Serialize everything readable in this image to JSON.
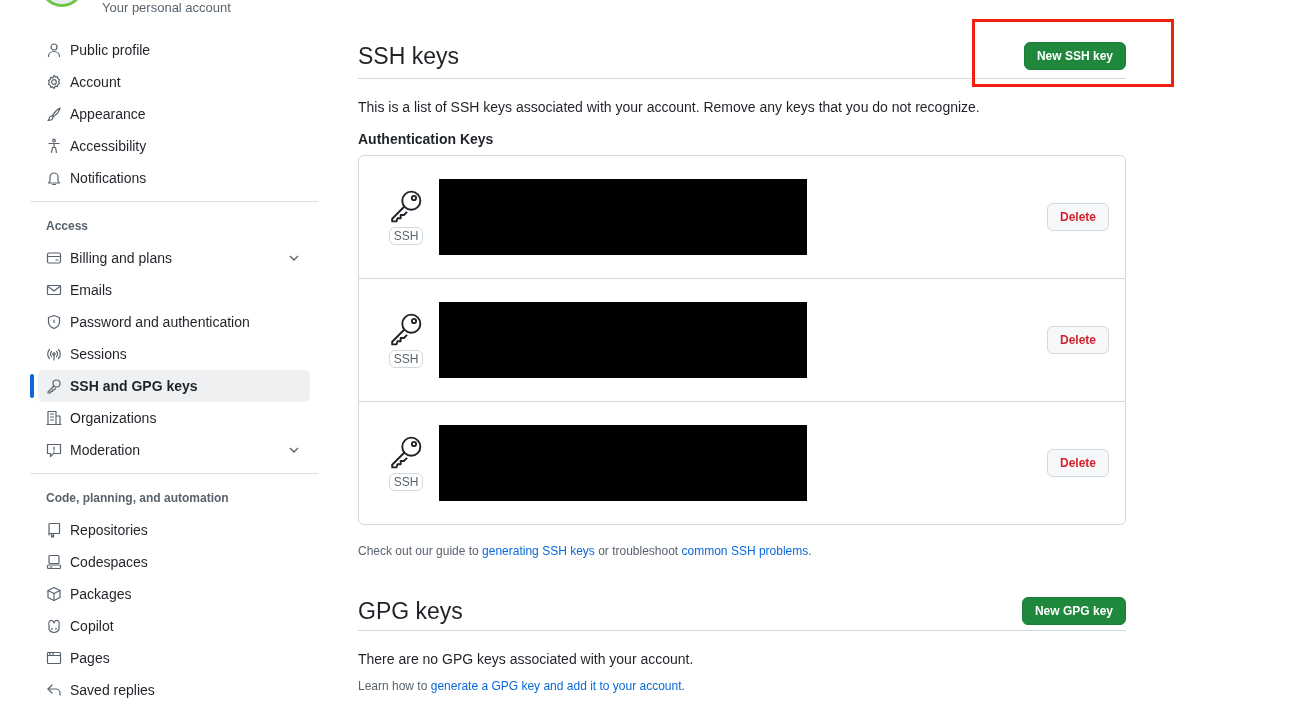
{
  "account_header": {
    "subtitle": "Your personal account"
  },
  "sidebar": {
    "groups": [
      {
        "items": [
          {
            "label": "Public profile",
            "selected": false,
            "has_submenu": false
          },
          {
            "label": "Account",
            "selected": false,
            "has_submenu": false
          },
          {
            "label": "Appearance",
            "selected": false,
            "has_submenu": false
          },
          {
            "label": "Accessibility",
            "selected": false,
            "has_submenu": false
          },
          {
            "label": "Notifications",
            "selected": false,
            "has_submenu": false
          }
        ]
      },
      {
        "heading": "Access",
        "items": [
          {
            "label": "Billing and plans",
            "selected": false,
            "has_submenu": true
          },
          {
            "label": "Emails",
            "selected": false,
            "has_submenu": false
          },
          {
            "label": "Password and authentication",
            "selected": false,
            "has_submenu": false
          },
          {
            "label": "Sessions",
            "selected": false,
            "has_submenu": false
          },
          {
            "label": "SSH and GPG keys",
            "selected": true,
            "has_submenu": false
          },
          {
            "label": "Organizations",
            "selected": false,
            "has_submenu": false
          },
          {
            "label": "Moderation",
            "selected": false,
            "has_submenu": true
          }
        ]
      },
      {
        "heading": "Code, planning, and automation",
        "items": [
          {
            "label": "Repositories",
            "selected": false,
            "has_submenu": false
          },
          {
            "label": "Codespaces",
            "selected": false,
            "has_submenu": false
          },
          {
            "label": "Packages",
            "selected": false,
            "has_submenu": false
          },
          {
            "label": "Copilot",
            "selected": false,
            "has_submenu": false
          },
          {
            "label": "Pages",
            "selected": false,
            "has_submenu": false
          },
          {
            "label": "Saved replies",
            "selected": false,
            "has_submenu": false
          }
        ]
      }
    ]
  },
  "ssh_section": {
    "title": "SSH keys",
    "button": "New SSH key",
    "highlighted": true,
    "description": "This is a list of SSH keys associated with your account. Remove any keys that you do not recognize.",
    "subheading": "Authentication Keys",
    "keys": [
      {
        "badge": "SSH",
        "action": "Delete"
      },
      {
        "badge": "SSH",
        "action": "Delete"
      },
      {
        "badge": "SSH",
        "action": "Delete"
      }
    ],
    "footer": [
      {
        "kind": "text",
        "text": "Check out our guide to "
      },
      {
        "kind": "link",
        "text": "generating SSH keys"
      },
      {
        "kind": "text",
        "text": " or troubleshoot "
      },
      {
        "kind": "link",
        "text": "common SSH problems"
      },
      {
        "kind": "text",
        "text": "."
      }
    ]
  },
  "gpg_section": {
    "title": "GPG keys",
    "button": "New GPG key",
    "highlighted": false,
    "description": "There are no GPG keys associated with your account.",
    "footer": [
      {
        "kind": "text",
        "text": "Learn how to "
      },
      {
        "kind": "link",
        "text": "generate a GPG key and add it to your account"
      },
      {
        "kind": "text",
        "text": "."
      }
    ]
  }
}
